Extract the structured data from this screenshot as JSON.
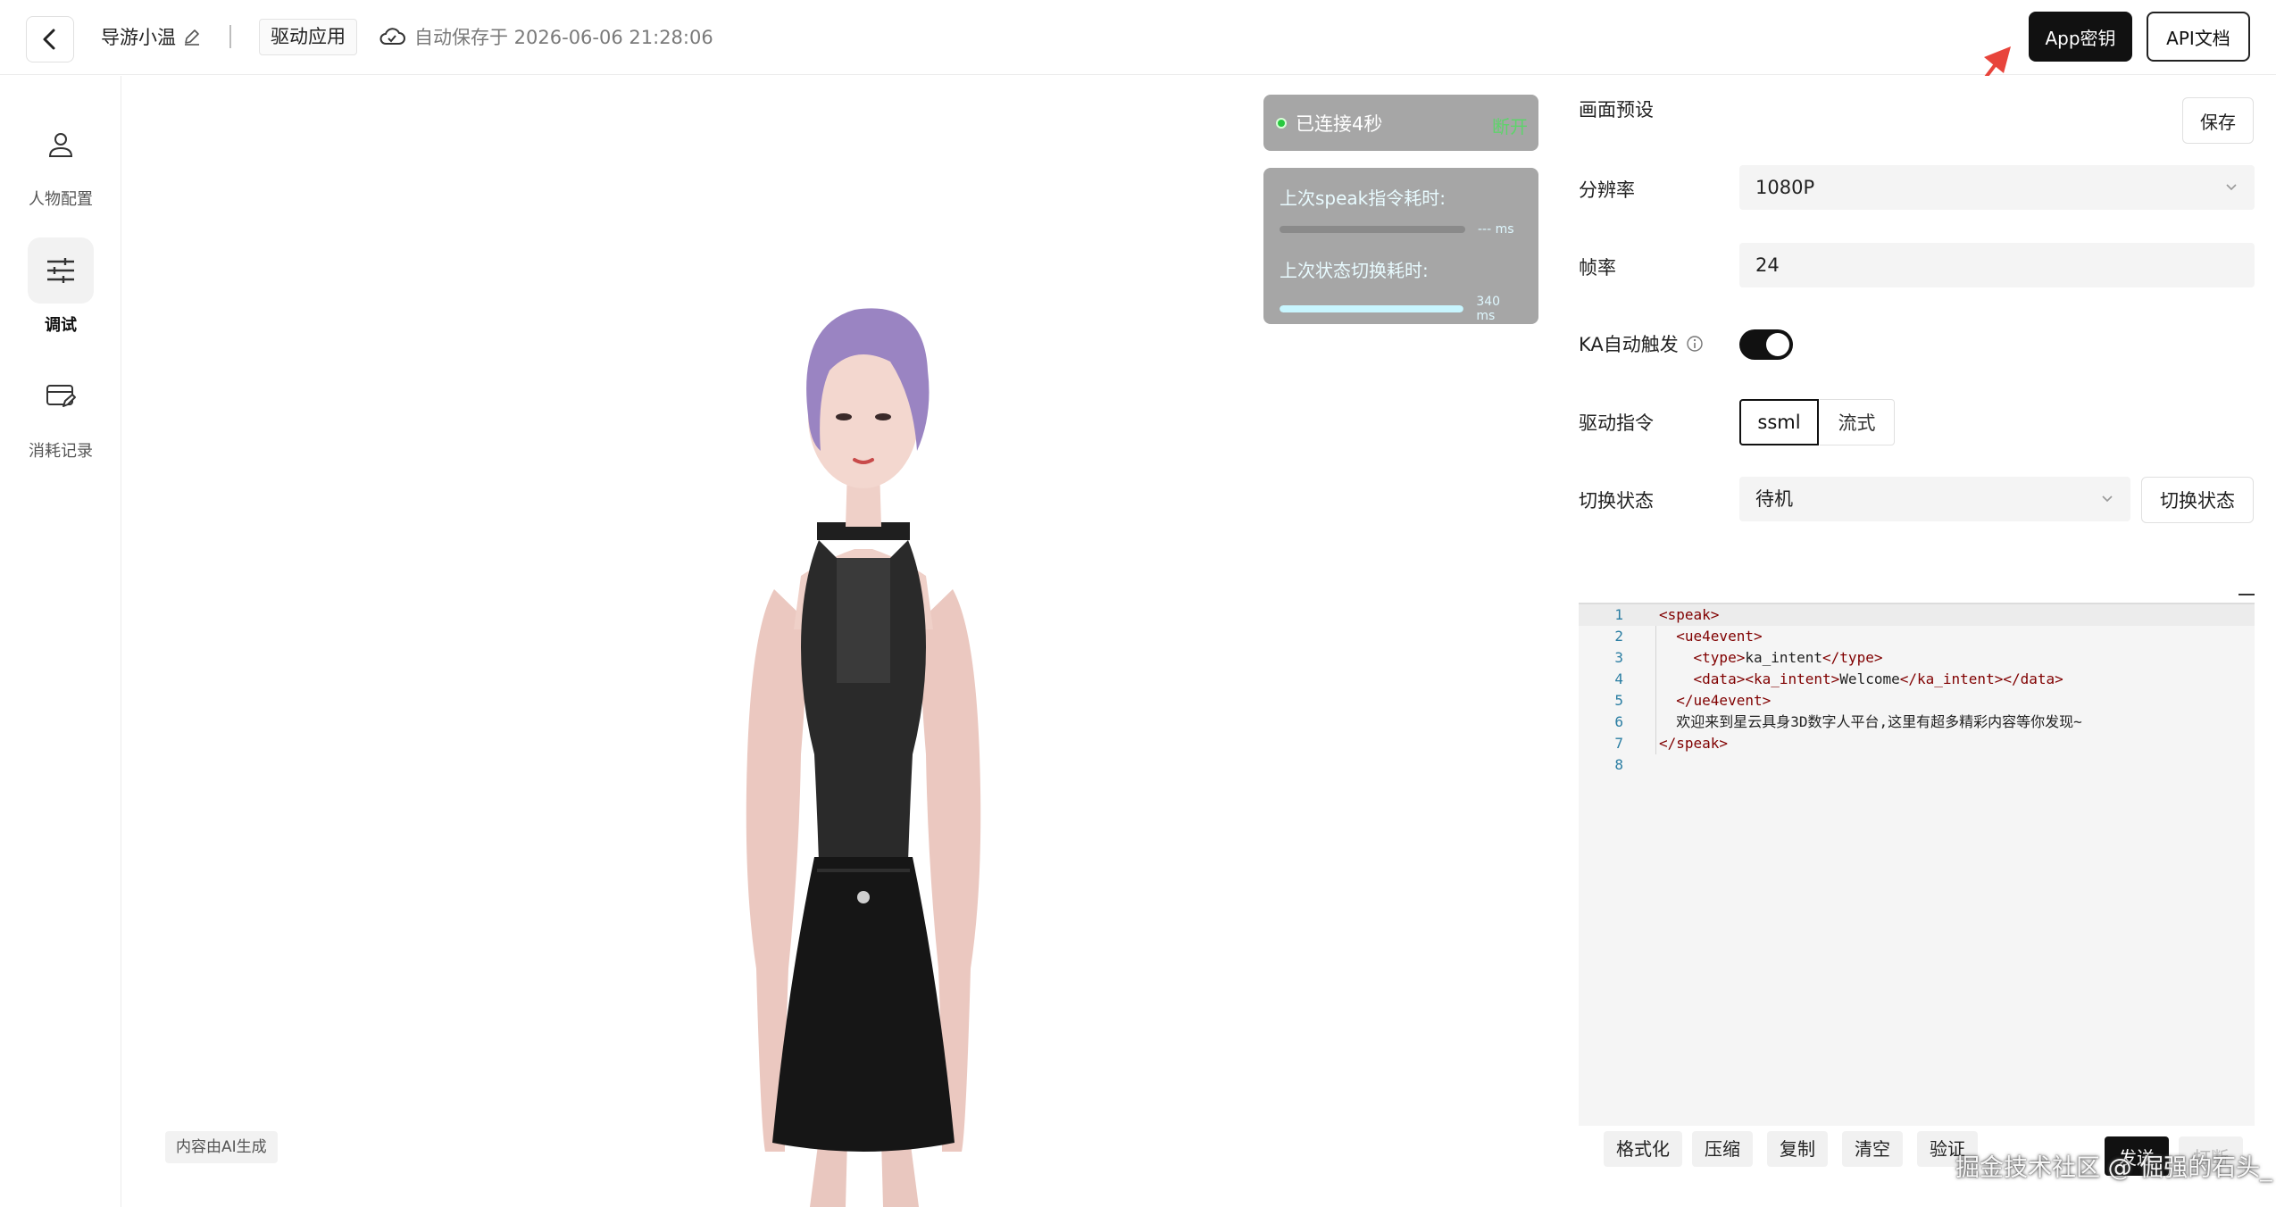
{
  "header": {
    "app_name": "导游小温",
    "tag": "驱动应用",
    "autosave": "自动保存于 2026-06-06 21:28:06",
    "app_key_button": "App密钥",
    "api_docs_button": "API文档"
  },
  "sidebar": {
    "items": [
      {
        "label": "人物配置",
        "icon": "person-icon"
      },
      {
        "label": "调试",
        "icon": "sliders-icon",
        "active": true
      },
      {
        "label": "消耗记录",
        "icon": "card-edit-icon"
      }
    ]
  },
  "stage": {
    "ai_tag": "内容由AI生成",
    "connection": {
      "status": "已连接4秒",
      "disconnect": "断开"
    },
    "metrics": [
      {
        "label": "上次speak指令耗时:",
        "value": "--- ms",
        "fill": 0
      },
      {
        "label": "上次状态切换耗时:",
        "value": "340 ms",
        "fill": 1.0
      }
    ]
  },
  "panel": {
    "section_title": "画面预设",
    "save_button": "保存",
    "resolution": {
      "label": "分辨率",
      "value": "1080P"
    },
    "framerate": {
      "label": "帧率",
      "value": "24"
    },
    "ka_trigger": {
      "label": "KA自动触发",
      "enabled": true
    },
    "drive_command": {
      "label": "驱动指令",
      "options": [
        "ssml",
        "流式"
      ],
      "selected": "ssml"
    },
    "switch_state": {
      "label": "切换状态",
      "value": "待机",
      "button": "切换状态"
    },
    "editor": {
      "line_numbers": [
        "1",
        "2",
        "3",
        "4",
        "5",
        "6",
        "7",
        "8"
      ],
      "lines": [
        "<speak>",
        "  <ue4event>",
        "    <type>ka_intent</type>",
        "    <data><ka_intent>Welcome</ka_intent></data>",
        "  </ue4event>",
        "  欢迎来到星云具身3D数字人平台,这里有超多精彩内容等你发现~",
        "</speak>",
        ""
      ]
    },
    "toolbar": {
      "format": "格式化",
      "compress": "压缩",
      "copy": "复制",
      "clear": "清空",
      "validate": "验证",
      "send": "发送",
      "interrupt": "打断"
    }
  },
  "watermark": "掘金技术社区 @ 倔强的石头_",
  "colors": {
    "accent": "#111111",
    "connected_dot": "#27c93f",
    "disconnect_text": "#5ed36b",
    "arrow": "#e8443b"
  }
}
